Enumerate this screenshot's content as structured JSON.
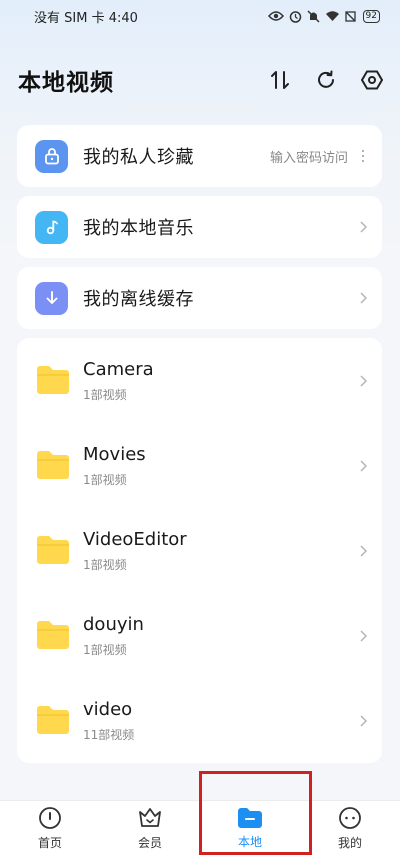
{
  "status_bar": {
    "carrier_time": "没有 SIM 卡 4:40",
    "battery": "92"
  },
  "header": {
    "title": "本地视频",
    "icons": [
      "sort-icon",
      "refresh-icon",
      "settings-icon"
    ]
  },
  "entries": [
    {
      "label": "我的私人珍藏",
      "hint": "输入密码访问",
      "icon": "lock-icon",
      "color": "#5b95f0"
    },
    {
      "label": "我的本地音乐",
      "icon": "music-note-icon",
      "color": "#44b6f3"
    },
    {
      "label": "我的离线缓存",
      "icon": "download-icon",
      "color": "#7b8ff5"
    }
  ],
  "folders": [
    {
      "name": "Camera",
      "count": "1部视频"
    },
    {
      "name": "Movies",
      "count": "1部视频"
    },
    {
      "name": "VideoEditor",
      "count": "1部视频"
    },
    {
      "name": "douyin",
      "count": "1部视频"
    },
    {
      "name": "video",
      "count": "11部视频"
    }
  ],
  "tabs": [
    {
      "label": "首页",
      "icon": "home-icon",
      "active": false
    },
    {
      "label": "会员",
      "icon": "vip-crown-icon",
      "active": false
    },
    {
      "label": "本地",
      "icon": "folder-icon",
      "active": true
    },
    {
      "label": "我的",
      "icon": "profile-icon",
      "active": false
    }
  ],
  "colors": {
    "accent": "#1d8ff2",
    "folder": "#ffd84e",
    "highlight": "#d0201f"
  }
}
